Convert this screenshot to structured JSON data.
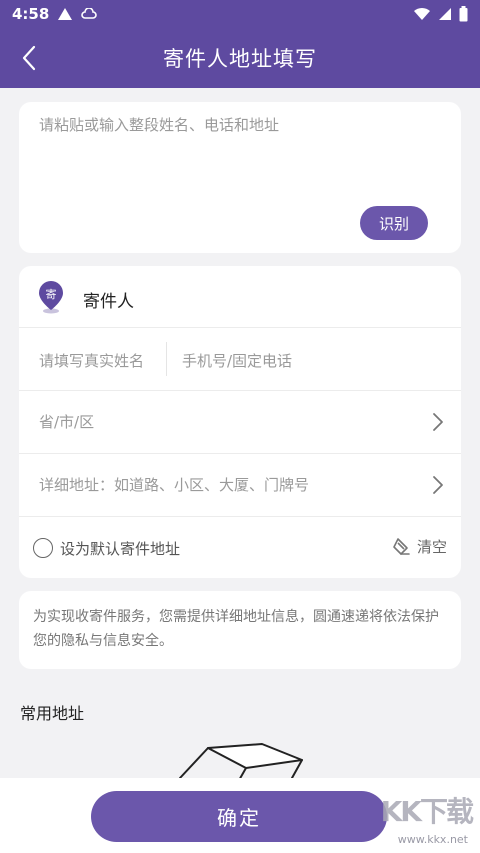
{
  "status_bar": {
    "time": "4:58",
    "left_icons": [
      "warning-triangle-icon",
      "cloud-icon"
    ],
    "right_icons": [
      "wifi-icon",
      "signal-icon",
      "battery-icon"
    ]
  },
  "nav": {
    "title": "寄件人地址填写",
    "back_icon": "chevron-left-icon"
  },
  "paste": {
    "placeholder": "请粘贴或输入整段姓名、电话和地址",
    "recognize_label": "识别"
  },
  "form": {
    "header_badge": "寄",
    "header_label": "寄件人",
    "name_placeholder": "请填写真实姓名",
    "phone_placeholder": "手机号/固定电话",
    "region_placeholder": "省/市/区",
    "detail_placeholder": "详细地址：如道路、小区、大厦、门牌号",
    "default_label": "设为默认寄件地址",
    "clear_label": "清空"
  },
  "notice": {
    "text": "为实现收寄件服务，您需提供详细地址信息，圆通速递将依法保护您的隐私与信息安全。"
  },
  "common": {
    "title": "常用地址"
  },
  "footer": {
    "confirm_label": "确定",
    "watermark_logo": "KK下载",
    "watermark_url": "www.kkx.net"
  },
  "colors": {
    "brand": "#5e4aa0",
    "button": "#6b57ab",
    "background": "#f2f2f4"
  }
}
